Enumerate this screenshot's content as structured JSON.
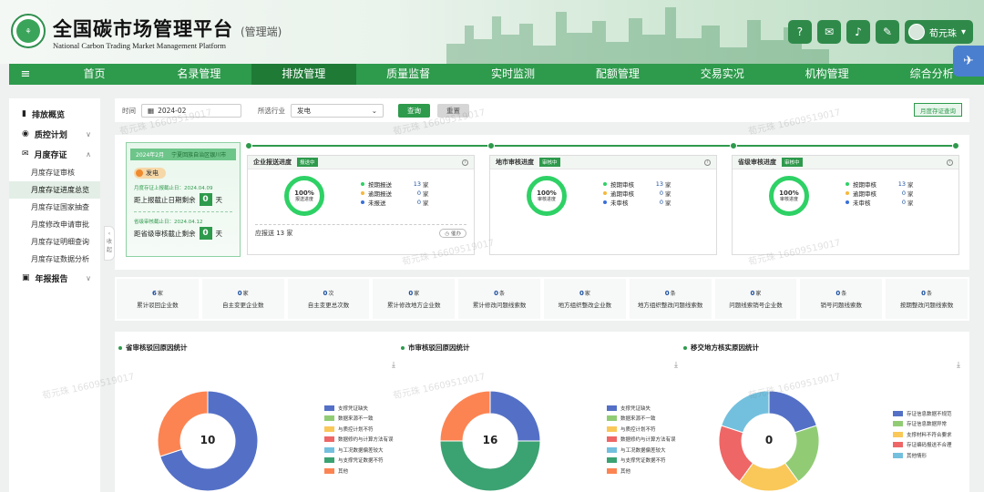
{
  "header": {
    "title": "全国碳市场管理平台",
    "subtitle_tag": "(管理端)",
    "title_en": "National Carbon Trading Market Management Platform",
    "user_name": "荀元珠",
    "icons": [
      "help-icon",
      "message-icon",
      "bell-icon",
      "edit-icon"
    ]
  },
  "nav": {
    "items": [
      {
        "label": "首页"
      },
      {
        "label": "名录管理"
      },
      {
        "label": "排放管理",
        "active": true
      },
      {
        "label": "质量监督"
      },
      {
        "label": "实时监测"
      },
      {
        "label": "配额管理"
      },
      {
        "label": "交易实况"
      },
      {
        "label": "机构管理"
      },
      {
        "label": "综合分析"
      }
    ]
  },
  "sidebar": {
    "groups": [
      {
        "label": "排放概览",
        "icon": "bar-chart-icon"
      },
      {
        "label": "质控计划",
        "icon": "palette-icon",
        "chev": "∨"
      },
      {
        "label": "月度存证",
        "icon": "mail-icon",
        "chev": "∧"
      }
    ],
    "subs": [
      {
        "label": "月度存证审核"
      },
      {
        "label": "月度存证进度总览",
        "active": true
      },
      {
        "label": "月度存证国家抽查"
      },
      {
        "label": "月度修改申请审批"
      },
      {
        "label": "月度存证明细查询"
      },
      {
        "label": "月度存证数据分析"
      }
    ],
    "last_group": {
      "label": "年报报告",
      "chev": "∨"
    },
    "collapse_label": "收起"
  },
  "filter": {
    "time_label": "时间",
    "time_value": "2024-02",
    "industry_label": "所选行业",
    "industry_value": "发电",
    "query_button": "查询",
    "reset_button": "重置",
    "right_button": "月度存证查询"
  },
  "deadline": {
    "strip_month": "2024年2月",
    "strip_region": "宁夏回族自治区银川市",
    "industry": "发电",
    "submit_small": "月度存证上报截止日：2024.04.09",
    "submit_text": "距上报截止日期剩余",
    "submit_days": "0",
    "audit_small": "省级审核截止日：2024.04.12",
    "audit_text": "距省级审核截止剩余",
    "audit_days": "0",
    "unit": "天"
  },
  "stages": [
    {
      "title": "企业报送进度",
      "badge": "报送中",
      "ring_value": "100%",
      "ring_label": "报送进度",
      "rows": [
        {
          "label": "按期报送",
          "value": "13",
          "unit": "家",
          "color": "#2ed165"
        },
        {
          "label": "逾期报送",
          "value": "0",
          "unit": "家",
          "color": "#f5b83d"
        },
        {
          "label": "未报送",
          "value": "0",
          "unit": "家",
          "color": "#3a6fd8"
        }
      ],
      "foot_text": "应报送 13 家",
      "foot_button": "催办"
    },
    {
      "title": "地市审核进度",
      "badge": "审核中",
      "ring_value": "100%",
      "ring_label": "审核进度",
      "rows": [
        {
          "label": "按期审核",
          "value": "13",
          "unit": "家",
          "color": "#2ed165"
        },
        {
          "label": "逾期审核",
          "value": "0",
          "unit": "家",
          "color": "#f5b83d"
        },
        {
          "label": "未审核",
          "value": "0",
          "unit": "家",
          "color": "#3a6fd8"
        }
      ]
    },
    {
      "title": "省级审核进度",
      "badge": "审核中",
      "ring_value": "100%",
      "ring_label": "审核进度",
      "rows": [
        {
          "label": "按期审核",
          "value": "13",
          "unit": "家",
          "color": "#2ed165"
        },
        {
          "label": "逾期审核",
          "value": "0",
          "unit": "家",
          "color": "#f5b83d"
        },
        {
          "label": "未审核",
          "value": "0",
          "unit": "家",
          "color": "#3a6fd8"
        }
      ]
    }
  ],
  "stats": [
    {
      "value": "6",
      "unit": "家",
      "label": "累计驳回企业数"
    },
    {
      "value": "0",
      "unit": "家",
      "label": "自主变更企业数"
    },
    {
      "value": "0",
      "unit": "次",
      "label": "自主变更总次数"
    },
    {
      "value": "0",
      "unit": "家",
      "label": "累计修改地方企业数"
    },
    {
      "value": "0",
      "unit": "条",
      "label": "累计修改问题线索数"
    },
    {
      "value": "0",
      "unit": "家",
      "label": "地方组织整改企业数"
    },
    {
      "value": "0",
      "unit": "条",
      "label": "地方组织整改问题线索数"
    },
    {
      "value": "0",
      "unit": "家",
      "label": "问题线索销号企业数"
    },
    {
      "value": "0",
      "unit": "条",
      "label": "销号问题线索数"
    },
    {
      "value": "0",
      "unit": "条",
      "label": "按期整改问题线索数"
    }
  ],
  "charts": {
    "titles": [
      "省审核驳回原因统计",
      "市审核驳回原因统计",
      "移交地方核实原因统计"
    ],
    "totals": [
      "10",
      "16",
      "0"
    ]
  },
  "chart_data": [
    {
      "type": "pie",
      "title": "省审核驳回原因统计",
      "center_value": 10,
      "labels": [
        "支撑凭证缺失",
        "数据来源不一致",
        "与质控计划不符",
        "数据修约与计算方法有误",
        "与工况数据偏差较大",
        "与支撑凭证数据不符",
        "其他"
      ],
      "colors": [
        "#5470c6",
        "#91cc75",
        "#fac858",
        "#ee6666",
        "#73c0de",
        "#3ba272",
        "#fc8452"
      ],
      "values": [
        7,
        0,
        0,
        0,
        0,
        0,
        3
      ]
    },
    {
      "type": "pie",
      "title": "市审核驳回原因统计",
      "center_value": 16,
      "labels": [
        "支撑凭证缺失",
        "数据来源不一致",
        "与质控计划不符",
        "数据修约与计算方法有误",
        "与工况数据偏差较大",
        "与支撑凭证数据不符",
        "其他"
      ],
      "colors": [
        "#5470c6",
        "#91cc75",
        "#fac858",
        "#ee6666",
        "#73c0de",
        "#3ba272",
        "#fc8452"
      ],
      "values": [
        4,
        0,
        0,
        0,
        0,
        8,
        4
      ]
    },
    {
      "type": "pie",
      "title": "移交地方核实原因统计",
      "center_value": 0,
      "labels": [
        "存证信息数据不规范",
        "存证信息数据异常",
        "支撑材料不符合要求",
        "存证编码报送不合理",
        "其他情形"
      ],
      "colors": [
        "#5470c6",
        "#91cc75",
        "#fac858",
        "#ee6666",
        "#73c0de"
      ],
      "values": [
        1,
        1,
        1,
        1,
        1
      ]
    }
  ],
  "watermark": "荀元珠 16609519017"
}
